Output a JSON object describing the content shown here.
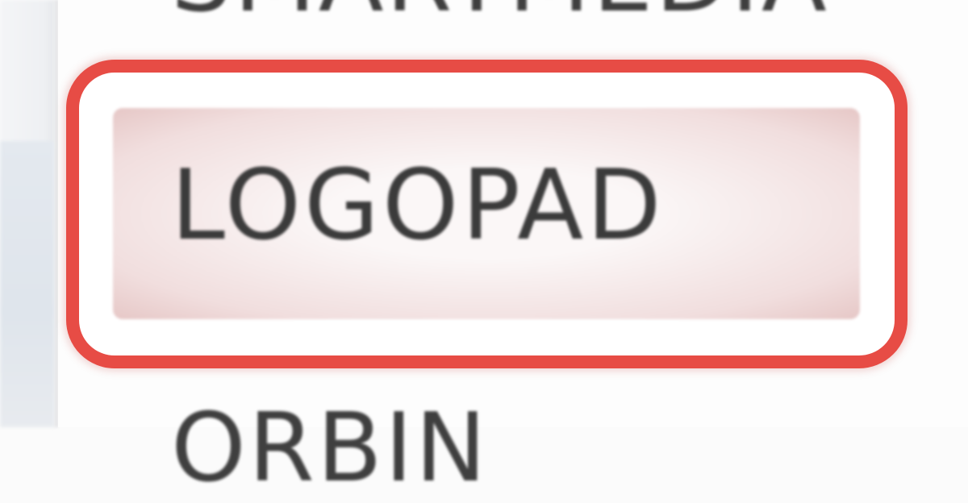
{
  "menu": {
    "items": [
      {
        "label": "SMARTMEDIA",
        "state": "partial-top"
      },
      {
        "label": "LOGOPAD",
        "state": "highlighted"
      },
      {
        "label": "ORBIN",
        "state": "partial-bottom"
      }
    ]
  },
  "colors": {
    "highlight_outline": "#e74c45",
    "item_text": "#3b3b3b",
    "item_background": "#f1dede",
    "panel_background": "#fdfdfd"
  }
}
